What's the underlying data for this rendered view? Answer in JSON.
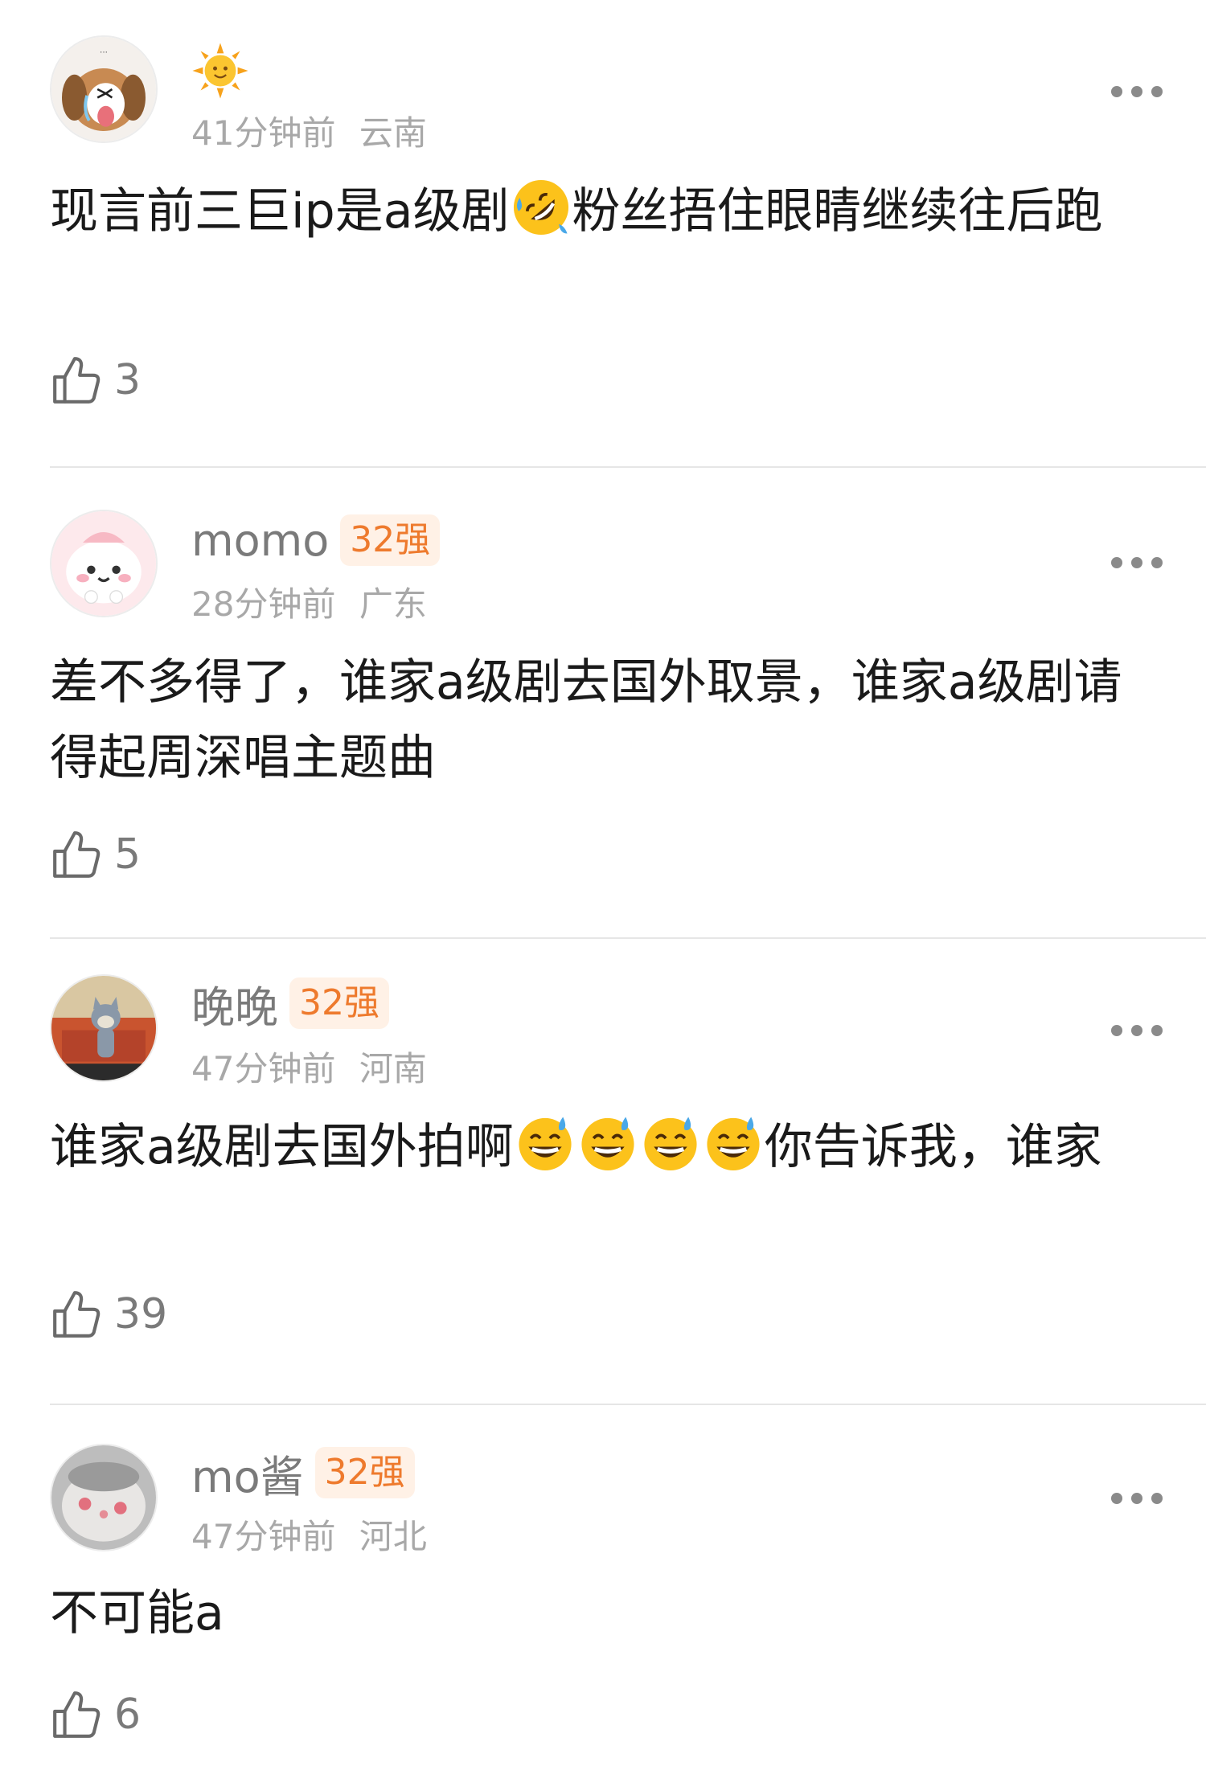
{
  "comments": [
    {
      "username": "",
      "badge": "",
      "time": "41分钟前",
      "location": "云南",
      "text_before": "现言前三巨ip是a级剧",
      "emoji": "rolling-on-floor-laughing",
      "text_after": "粉丝捂住眼睛继续往后跑",
      "likes": "3"
    },
    {
      "username": "momo",
      "badge": "32强",
      "time": "28分钟前",
      "location": "广东",
      "text": "差不多得了，谁家a级剧去国外取景，谁家a级剧请得起周深唱主题曲",
      "likes": "5"
    },
    {
      "username": "晚晚",
      "badge": "32强",
      "time": "47分钟前",
      "location": "河南",
      "text_before": "谁家a级剧去国外拍啊",
      "emoji": "grinning-face-with-sweat",
      "emoji_count": 4,
      "text_after": "你告诉我，谁家",
      "likes": "39"
    },
    {
      "username": "mo酱",
      "badge": "32强",
      "time": "47分钟前",
      "location": "河北",
      "text": "不可能a",
      "likes": "6"
    }
  ],
  "icons": {
    "more": "more-dots-icon",
    "like": "thumbs-up-icon",
    "sun": "sun-icon"
  },
  "colors": {
    "badge_text": "#ee7a2d",
    "badge_bg": "#fff1e6",
    "meta": "#a8a8a8"
  }
}
